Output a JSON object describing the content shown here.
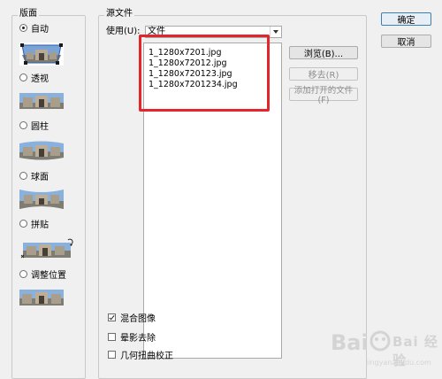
{
  "layout_group": {
    "title": "版面",
    "options": [
      {
        "label": "自动",
        "checked": true
      },
      {
        "label": "透视",
        "checked": false
      },
      {
        "label": "圆柱",
        "checked": false
      },
      {
        "label": "球面",
        "checked": false
      },
      {
        "label": "拼贴",
        "checked": false
      },
      {
        "label": "调整位置",
        "checked": false
      }
    ]
  },
  "source_group": {
    "title": "源文件",
    "use_label": "使用(U):",
    "use_value": "文件",
    "files": [
      "1_1280x7201.jpg",
      "1_1280x72012.jpg",
      "1_1280x720123.jpg",
      "1_1280x7201234.jpg"
    ]
  },
  "buttons": {
    "ok": "确定",
    "cancel": "取消",
    "browse": "浏览(B)...",
    "remove": "移去(R)",
    "add_open": "添加打开的文件(F)"
  },
  "checkboxes": [
    {
      "label": "混合图像",
      "checked": true
    },
    {
      "label": "晕影去除",
      "checked": false
    },
    {
      "label": "几何扭曲校正",
      "checked": false
    }
  ],
  "watermark": {
    "text": "Bai 经验",
    "sub": "jingyan.baidu.com"
  },
  "colors": {
    "highlight_box": "#e2262c",
    "dialog_bg": "#f0f0f0"
  }
}
